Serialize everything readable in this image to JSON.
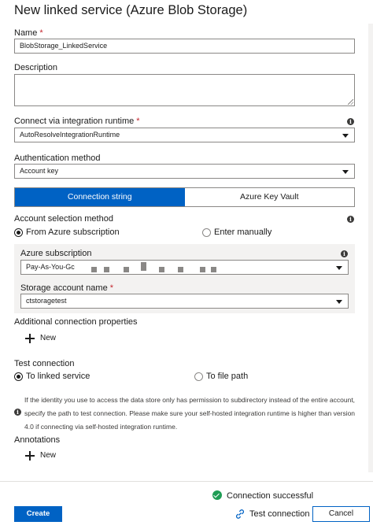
{
  "header": {
    "title": "New linked service (Azure Blob Storage)"
  },
  "name": {
    "label": "Name",
    "required_mark": "*",
    "value": "BlobStorage_LinkedService"
  },
  "description": {
    "label": "Description",
    "value": ""
  },
  "runtime": {
    "label": "Connect via integration runtime",
    "required_mark": "*",
    "value": "AutoResolveIntegrationRuntime",
    "info_icon": "info-icon"
  },
  "auth": {
    "label": "Authentication method",
    "value": "Account key"
  },
  "tabs": [
    {
      "label": "Connection string",
      "active": true
    },
    {
      "label": "Azure Key Vault",
      "active": false
    }
  ],
  "account_selection": {
    "label": "Account selection method",
    "options": [
      {
        "label": "From Azure subscription",
        "selected": true
      },
      {
        "label": "Enter manually",
        "selected": false
      }
    ]
  },
  "subscription": {
    "label": "Azure subscription",
    "value": "Pay-As-You-Gc"
  },
  "storage_account": {
    "label": "Storage account name",
    "required_mark": "*",
    "value": "ctstoragetest"
  },
  "additional_props": {
    "label": "Additional connection properties",
    "new_label": "New"
  },
  "test_connection": {
    "label": "Test connection",
    "options": [
      {
        "label": "To linked service",
        "selected": true
      },
      {
        "label": "To file path",
        "selected": false
      }
    ],
    "note": "If the identity you use to access the data store only has permission to subdirectory instead of the entire account, specify the path to test connection. Please make sure your self-hosted integration runtime is higher than version 4.0 if connecting via self-hosted integration runtime."
  },
  "annotations": {
    "label": "Annotations",
    "new_label": "New"
  },
  "footer": {
    "status": "Connection successful",
    "create_label": "Create",
    "test_label": "Test connection",
    "cancel_label": "Cancel"
  },
  "colors": {
    "accent": "#0062c4",
    "success": "#1f9d55",
    "required": "#c4262e"
  }
}
